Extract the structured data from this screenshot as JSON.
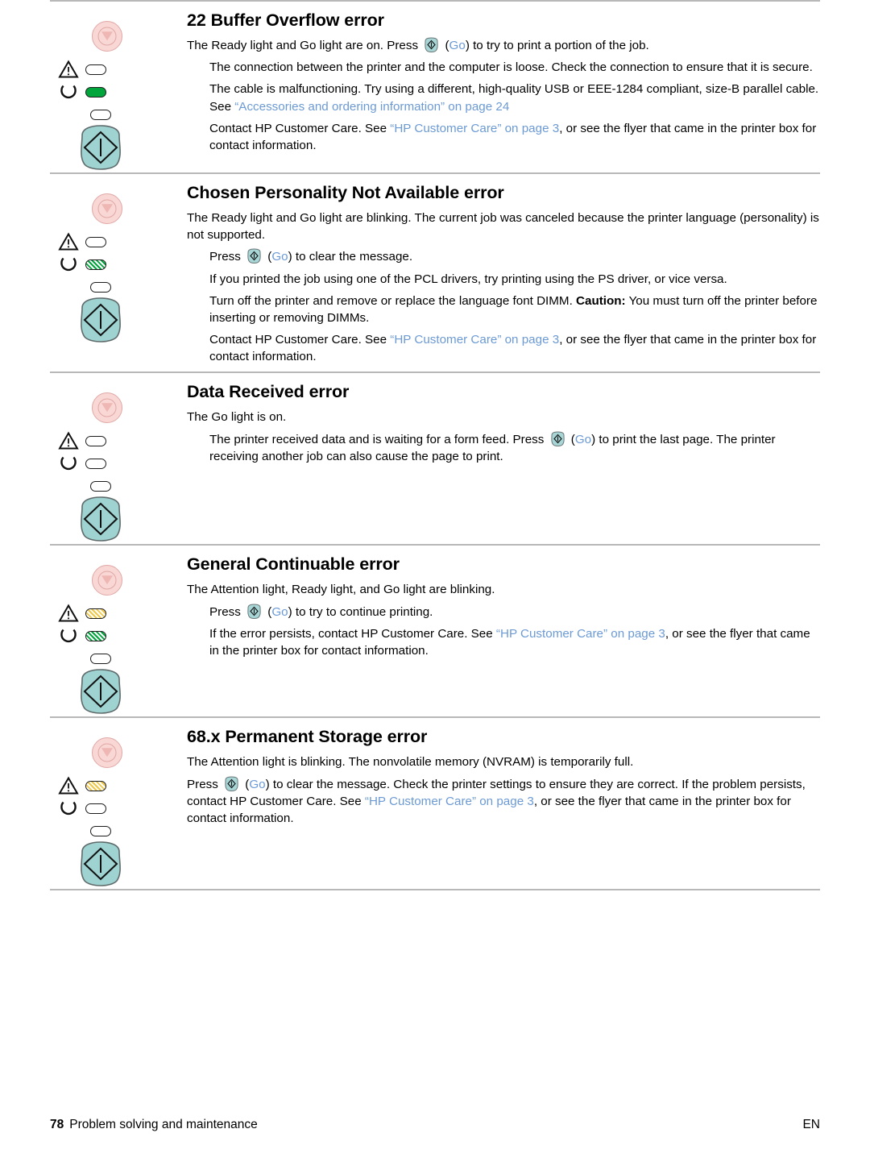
{
  "page": {
    "footer_page_number": "78",
    "footer_title": "Problem solving and maintenance",
    "footer_language": "EN"
  },
  "colors": {
    "link": "#6c9ad4",
    "led_green": "#00a63c",
    "led_amber": "#efc84a",
    "go_button_teal": "#9ed3d2",
    "cancel_button_pink": "#f8d7d5",
    "rule_gray": "#b8b8b8"
  },
  "sections": [
    {
      "id": "buffer-overflow",
      "title": "22 Buffer Overflow error",
      "panel": {
        "attention_led": "off",
        "ready_led": "on-green",
        "go_led": "on-green"
      },
      "paragraphs": [
        {
          "indent": false,
          "runs": [
            {
              "type": "text",
              "text": "The Ready light and Go light are on. Press "
            },
            {
              "type": "go-icon"
            },
            {
              "type": "text",
              "text": " ("
            },
            {
              "type": "link",
              "text": "Go"
            },
            {
              "type": "text",
              "text": ") to try to print a portion of the job."
            }
          ]
        },
        {
          "indent": true,
          "runs": [
            {
              "type": "text",
              "text": "The connection between the printer and the computer is loose. Check the connection to ensure that it is secure."
            }
          ]
        },
        {
          "indent": true,
          "runs": [
            {
              "type": "text",
              "text": "The cable is malfunctioning. Try using a different, high-quality USB or EEE-1284 compliant, size-B parallel cable. See "
            },
            {
              "type": "link",
              "text": "“Accessories and ordering information” on page 24"
            }
          ]
        },
        {
          "indent": true,
          "runs": [
            {
              "type": "text",
              "text": "Contact HP Customer Care. See "
            },
            {
              "type": "link",
              "text": "“HP Customer Care” on page 3"
            },
            {
              "type": "text",
              "text": ", or see the flyer that came in the printer box for contact information."
            }
          ]
        }
      ]
    },
    {
      "id": "chosen-personality-not-available",
      "title": "Chosen Personality Not Available error",
      "panel": {
        "attention_led": "off",
        "ready_led": "blink-green",
        "go_led": "blink-green"
      },
      "paragraphs": [
        {
          "indent": false,
          "runs": [
            {
              "type": "text",
              "text": "The Ready light and Go light are blinking. The current job was canceled because the printer language (personality) is not supported."
            }
          ]
        },
        {
          "indent": true,
          "runs": [
            {
              "type": "text",
              "text": "Press "
            },
            {
              "type": "go-icon"
            },
            {
              "type": "text",
              "text": " ("
            },
            {
              "type": "link",
              "text": "Go"
            },
            {
              "type": "text",
              "text": ") to clear the message."
            }
          ]
        },
        {
          "indent": true,
          "runs": [
            {
              "type": "text",
              "text": "If you printed the job using one of the PCL drivers, try printing using the PS driver, or vice versa."
            }
          ]
        },
        {
          "indent": true,
          "runs": [
            {
              "type": "text",
              "text": "Turn off the printer and remove or replace the language font DIMM. "
            },
            {
              "type": "bold",
              "text": "Caution:"
            },
            {
              "type": "text",
              "text": " You must turn off the printer before inserting or removing DIMMs."
            }
          ]
        },
        {
          "indent": true,
          "runs": [
            {
              "type": "text",
              "text": "Contact HP Customer Care. See "
            },
            {
              "type": "link",
              "text": "“HP Customer Care” on page 3"
            },
            {
              "type": "text",
              "text": ", or see the flyer that came in the printer box for contact information."
            }
          ]
        }
      ]
    },
    {
      "id": "data-received",
      "title": "Data Received error",
      "panel": {
        "attention_led": "off",
        "ready_led": "off",
        "go_led": "on-green"
      },
      "paragraphs": [
        {
          "indent": false,
          "runs": [
            {
              "type": "text",
              "text": "The Go light is on."
            }
          ]
        },
        {
          "indent": true,
          "runs": [
            {
              "type": "text",
              "text": "The printer received data and is waiting for a form feed. Press "
            },
            {
              "type": "go-icon"
            },
            {
              "type": "text",
              "text": " ("
            },
            {
              "type": "link",
              "text": "Go"
            },
            {
              "type": "text",
              "text": ") to print the last page. The printer receiving another job can also cause the page to print."
            }
          ]
        }
      ]
    },
    {
      "id": "general-continuable",
      "title": "General Continuable error",
      "panel": {
        "attention_led": "blink-amber",
        "ready_led": "blink-green",
        "go_led": "blink-green"
      },
      "paragraphs": [
        {
          "indent": false,
          "runs": [
            {
              "type": "text",
              "text": "The Attention light, Ready light, and Go light are blinking."
            }
          ]
        },
        {
          "indent": true,
          "runs": [
            {
              "type": "text",
              "text": "Press "
            },
            {
              "type": "go-icon"
            },
            {
              "type": "text",
              "text": " ("
            },
            {
              "type": "link",
              "text": "Go"
            },
            {
              "type": "text",
              "text": ") to try to continue printing."
            }
          ]
        },
        {
          "indent": true,
          "runs": [
            {
              "type": "text",
              "text": "If the error persists, contact HP Customer Care. See "
            },
            {
              "type": "link",
              "text": "“HP Customer Care” on page 3"
            },
            {
              "type": "text",
              "text": ", or see the flyer that came in the printer box for contact information."
            }
          ]
        }
      ]
    },
    {
      "id": "permanent-storage",
      "title": "68.x Permanent Storage error",
      "panel": {
        "attention_led": "blink-amber",
        "ready_led": "off",
        "go_led": "off"
      },
      "paragraphs": [
        {
          "indent": false,
          "runs": [
            {
              "type": "text",
              "text": "The Attention light is blinking. The nonvolatile memory (NVRAM) is temporarily full."
            }
          ]
        },
        {
          "indent": false,
          "runs": [
            {
              "type": "text",
              "text": "Press "
            },
            {
              "type": "go-icon"
            },
            {
              "type": "text",
              "text": " ("
            },
            {
              "type": "link",
              "text": "Go"
            },
            {
              "type": "text",
              "text": ") to clear the message. Check the printer settings to ensure they are correct. If the problem persists, contact HP Customer Care. See "
            },
            {
              "type": "link",
              "text": "“HP Customer Care” on page 3"
            },
            {
              "type": "text",
              "text": ", or see the flyer that came in the printer box for contact information."
            }
          ]
        }
      ]
    }
  ]
}
